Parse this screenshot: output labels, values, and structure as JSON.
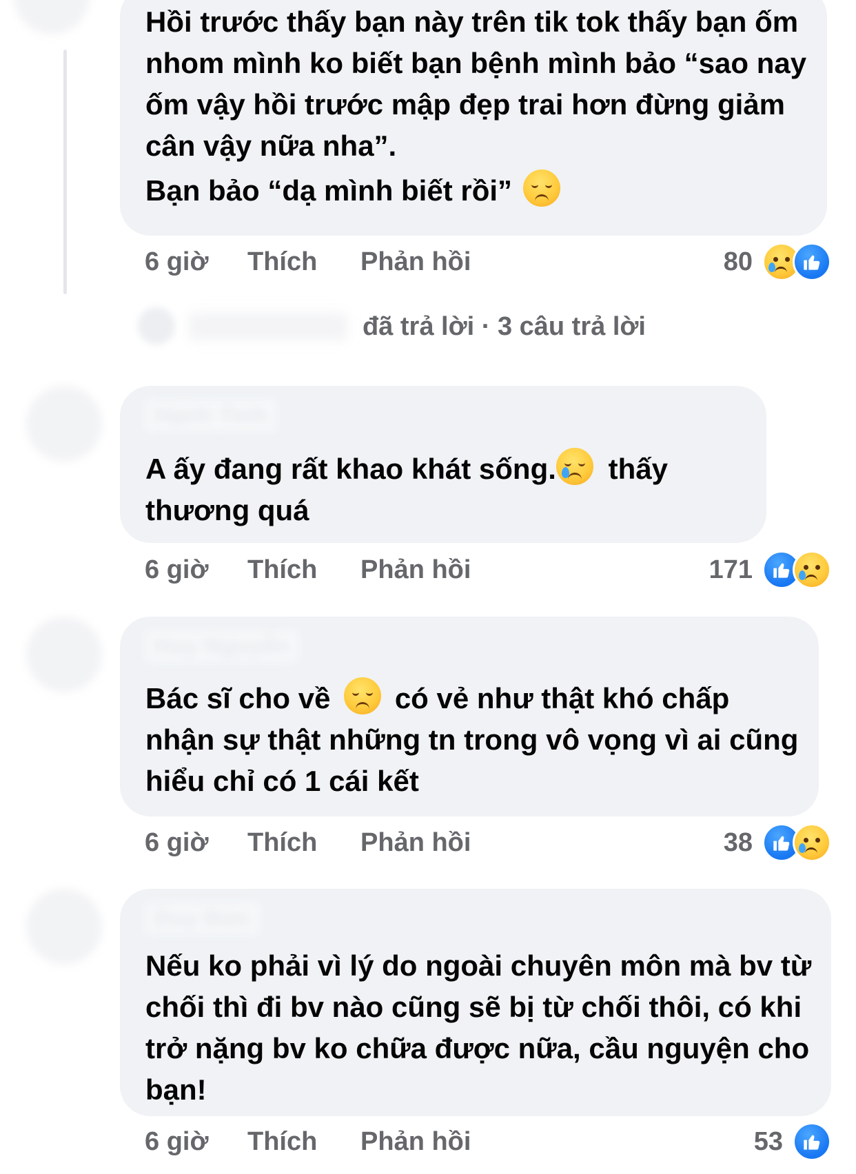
{
  "comments": [
    {
      "lines": [
        "Hồi trước thấy bạn này trên tik tok thấy bạn ốm nhom mình ko biết bạn bệnh mình bảo “sao nay ốm vậy hồi trước mập đẹp trai hơn đừng giảm cân vậy nữa nha”.",
        "Bạn bảo “dạ mình biết rồi”"
      ],
      "emoji": "disappointed-face",
      "time": "6 giờ",
      "like_label": "Thích",
      "reply_label": "Phản hồi",
      "reaction_count": "80",
      "reactions": [
        "sad",
        "like"
      ]
    },
    {
      "author": "Hạnh Tinh",
      "text_before_emoji": "A ấy đang rất khao khát sống.",
      "emoji": "crying-face",
      "text_after_emoji": "thấy thương quá",
      "time": "6 giờ",
      "like_label": "Thích",
      "reply_label": "Phản hồi",
      "reaction_count": "171",
      "reactions": [
        "like",
        "sad"
      ]
    },
    {
      "author": "Huy Nguyễn",
      "text_before_emoji": "Bác sĩ cho về",
      "emoji": "disappointed-face",
      "text_after_emoji": "có vẻ như thật khó chấp nhận sự thật những tn trong vô vọng vì ai cũng hiểu chỉ có 1 cái kết",
      "time": "6 giờ",
      "like_label": "Thích",
      "reply_label": "Phản hồi",
      "reaction_count": "38",
      "reactions": [
        "like",
        "sad"
      ]
    },
    {
      "author": "Duy Đức",
      "text": "Nếu ko phải vì lý do ngoài chuyên môn mà bv từ chối thì đi bv nào cũng sẽ bị từ chối thôi, có khi trở nặng bv ko chữa được nữa, cầu nguyện cho bạn!",
      "time": "6 giờ",
      "like_label": "Thích",
      "reply_label": "Phản hồi",
      "reaction_count": "53",
      "reactions": [
        "like"
      ]
    }
  ],
  "replies_summary": {
    "replied_label": "đã trả lời",
    "separator": " · ",
    "count_label": "3 câu trả lời"
  },
  "colors": {
    "bubble": "#f0f2f5",
    "meta_text": "#65676b",
    "like_blue": "#1877f2",
    "emoji_yellow": "#ffcb3d"
  }
}
